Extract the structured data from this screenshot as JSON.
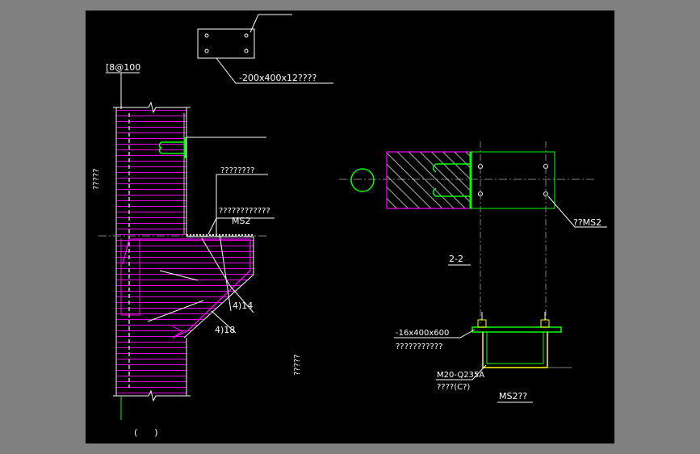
{
  "colors": {
    "background": "#000000",
    "frame": "#808080",
    "concrete_outline": "#ffffff",
    "hatch": "#ff00ff",
    "steel": "#00ff00",
    "rebar": "#ffff00",
    "leader": "#ffffff",
    "centerline": "#808080"
  },
  "labels": {
    "plate_spec": "-200x400x12????",
    "rebar_spec": "[8@100",
    "side_note": "?????",
    "annot_1": "????????",
    "annot_2": "????????????",
    "ms2_left": "MS2",
    "bar_1": "4)14",
    "bar_2": "4)18",
    "center_note": "?????",
    "title_paren": "(      )",
    "ms2_right": "??MS2",
    "section": "2-2",
    "plate_2": "-16x400x600",
    "plate_2_note": "???????????",
    "bolt_spec": "M20-Q235A",
    "bolt_note": "????(C?)",
    "detail_title": "MS2??"
  }
}
